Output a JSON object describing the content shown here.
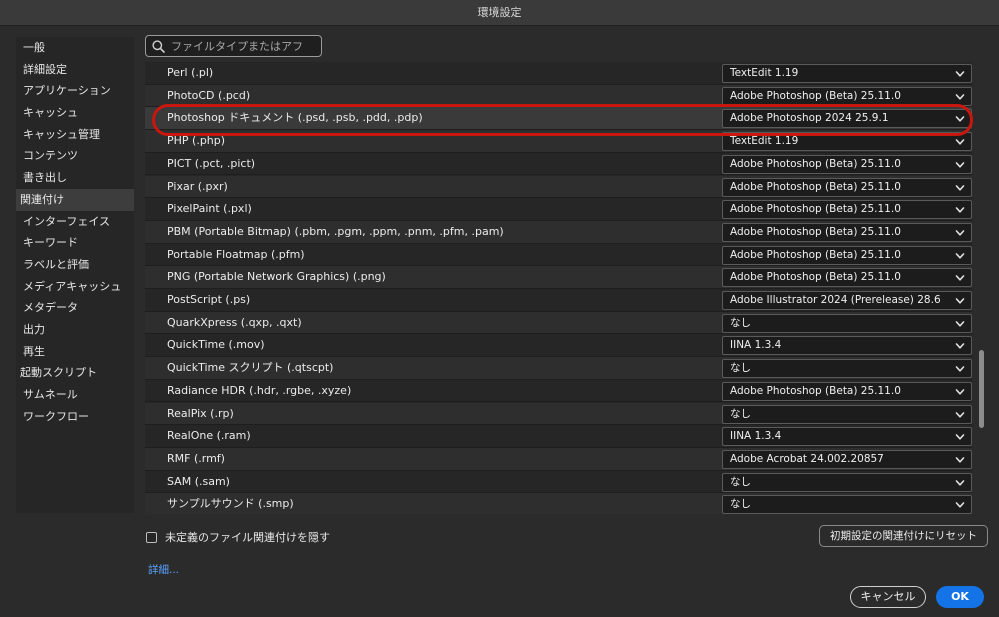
{
  "window": {
    "title": "環境設定"
  },
  "sidebar": {
    "items": [
      {
        "label": "一般",
        "selected": false
      },
      {
        "label": "詳細設定",
        "selected": false
      },
      {
        "label": "アプリケーション",
        "selected": false
      },
      {
        "label": "キャッシュ",
        "selected": false
      },
      {
        "label": "キャッシュ管理",
        "selected": false
      },
      {
        "label": "コンテンツ",
        "selected": false
      },
      {
        "label": "書き出し",
        "selected": false
      },
      {
        "label": "関連付け",
        "selected": true
      },
      {
        "label": "インターフェイス",
        "selected": false
      },
      {
        "label": "キーワード",
        "selected": false
      },
      {
        "label": "ラベルと評価",
        "selected": false
      },
      {
        "label": "メディアキャッシュ",
        "selected": false
      },
      {
        "label": "メタデータ",
        "selected": false
      },
      {
        "label": "出力",
        "selected": false
      },
      {
        "label": "再生",
        "selected": false
      },
      {
        "label": "起動スクリプト",
        "selected": false
      },
      {
        "label": "サムネール",
        "selected": false
      },
      {
        "label": "ワークフロー",
        "selected": false
      }
    ]
  },
  "search": {
    "placeholder": "ファイルタイプまたはアフ",
    "value": ""
  },
  "associations": {
    "rows": [
      {
        "file_type": "Perl (.pl)",
        "app": "TextEdit 1.19"
      },
      {
        "file_type": "PhotoCD (.pcd)",
        "app": "Adobe Photoshop (Beta) 25.11.0"
      },
      {
        "file_type": "Photoshop ドキュメント (.psd, .psb, .pdd, .pdp)",
        "app": "Adobe Photoshop 2024 25.9.1",
        "highlighted": true
      },
      {
        "file_type": "PHP (.php)",
        "app": "TextEdit 1.19"
      },
      {
        "file_type": "PICT (.pct, .pict)",
        "app": "Adobe Photoshop (Beta) 25.11.0"
      },
      {
        "file_type": "Pixar (.pxr)",
        "app": "Adobe Photoshop (Beta) 25.11.0"
      },
      {
        "file_type": "PixelPaint (.pxl)",
        "app": "Adobe Photoshop (Beta) 25.11.0"
      },
      {
        "file_type": "PBM (Portable Bitmap) (.pbm, .pgm, .ppm, .pnm, .pfm, .pam)",
        "app": "Adobe Photoshop (Beta) 25.11.0"
      },
      {
        "file_type": "Portable Floatmap (.pfm)",
        "app": "Adobe Photoshop (Beta) 25.11.0"
      },
      {
        "file_type": "PNG (Portable Network Graphics) (.png)",
        "app": "Adobe Photoshop (Beta) 25.11.0"
      },
      {
        "file_type": "PostScript (.ps)",
        "app": "Adobe Illustrator 2024 (Prerelease) 28.6"
      },
      {
        "file_type": "QuarkXpress (.qxp, .qxt)",
        "app": "なし"
      },
      {
        "file_type": "QuickTime (.mov)",
        "app": "IINA 1.3.4"
      },
      {
        "file_type": "QuickTime スクリプト (.qtscpt)",
        "app": "なし"
      },
      {
        "file_type": "Radiance HDR (.hdr, .rgbe, .xyze)",
        "app": "Adobe Photoshop (Beta) 25.11.0"
      },
      {
        "file_type": "RealPix (.rp)",
        "app": "なし"
      },
      {
        "file_type": "RealOne (.ram)",
        "app": "IINA 1.3.4"
      },
      {
        "file_type": "RMF (.rmf)",
        "app": "Adobe Acrobat 24.002.20857"
      },
      {
        "file_type": "SAM (.sam)",
        "app": "なし"
      },
      {
        "file_type": "サンプルサウンド (.smp)",
        "app": "なし"
      }
    ]
  },
  "footer": {
    "hide_undefined_label": "未定義のファイル関連付けを隠す",
    "hide_undefined_checked": false,
    "reset_label": "初期設定の関連付けにリセット",
    "details_link": "詳細...",
    "cancel_label": "キャンセル",
    "ok_label": "OK"
  },
  "colors": {
    "background": "#2b2b2b",
    "panel": "#262626",
    "accent": "#1473e6",
    "link": "#5ba3ff",
    "annotation_ring": "#c9170f"
  },
  "icons": {
    "search": "search-icon",
    "dropdown": "chevron-updown-icon"
  }
}
